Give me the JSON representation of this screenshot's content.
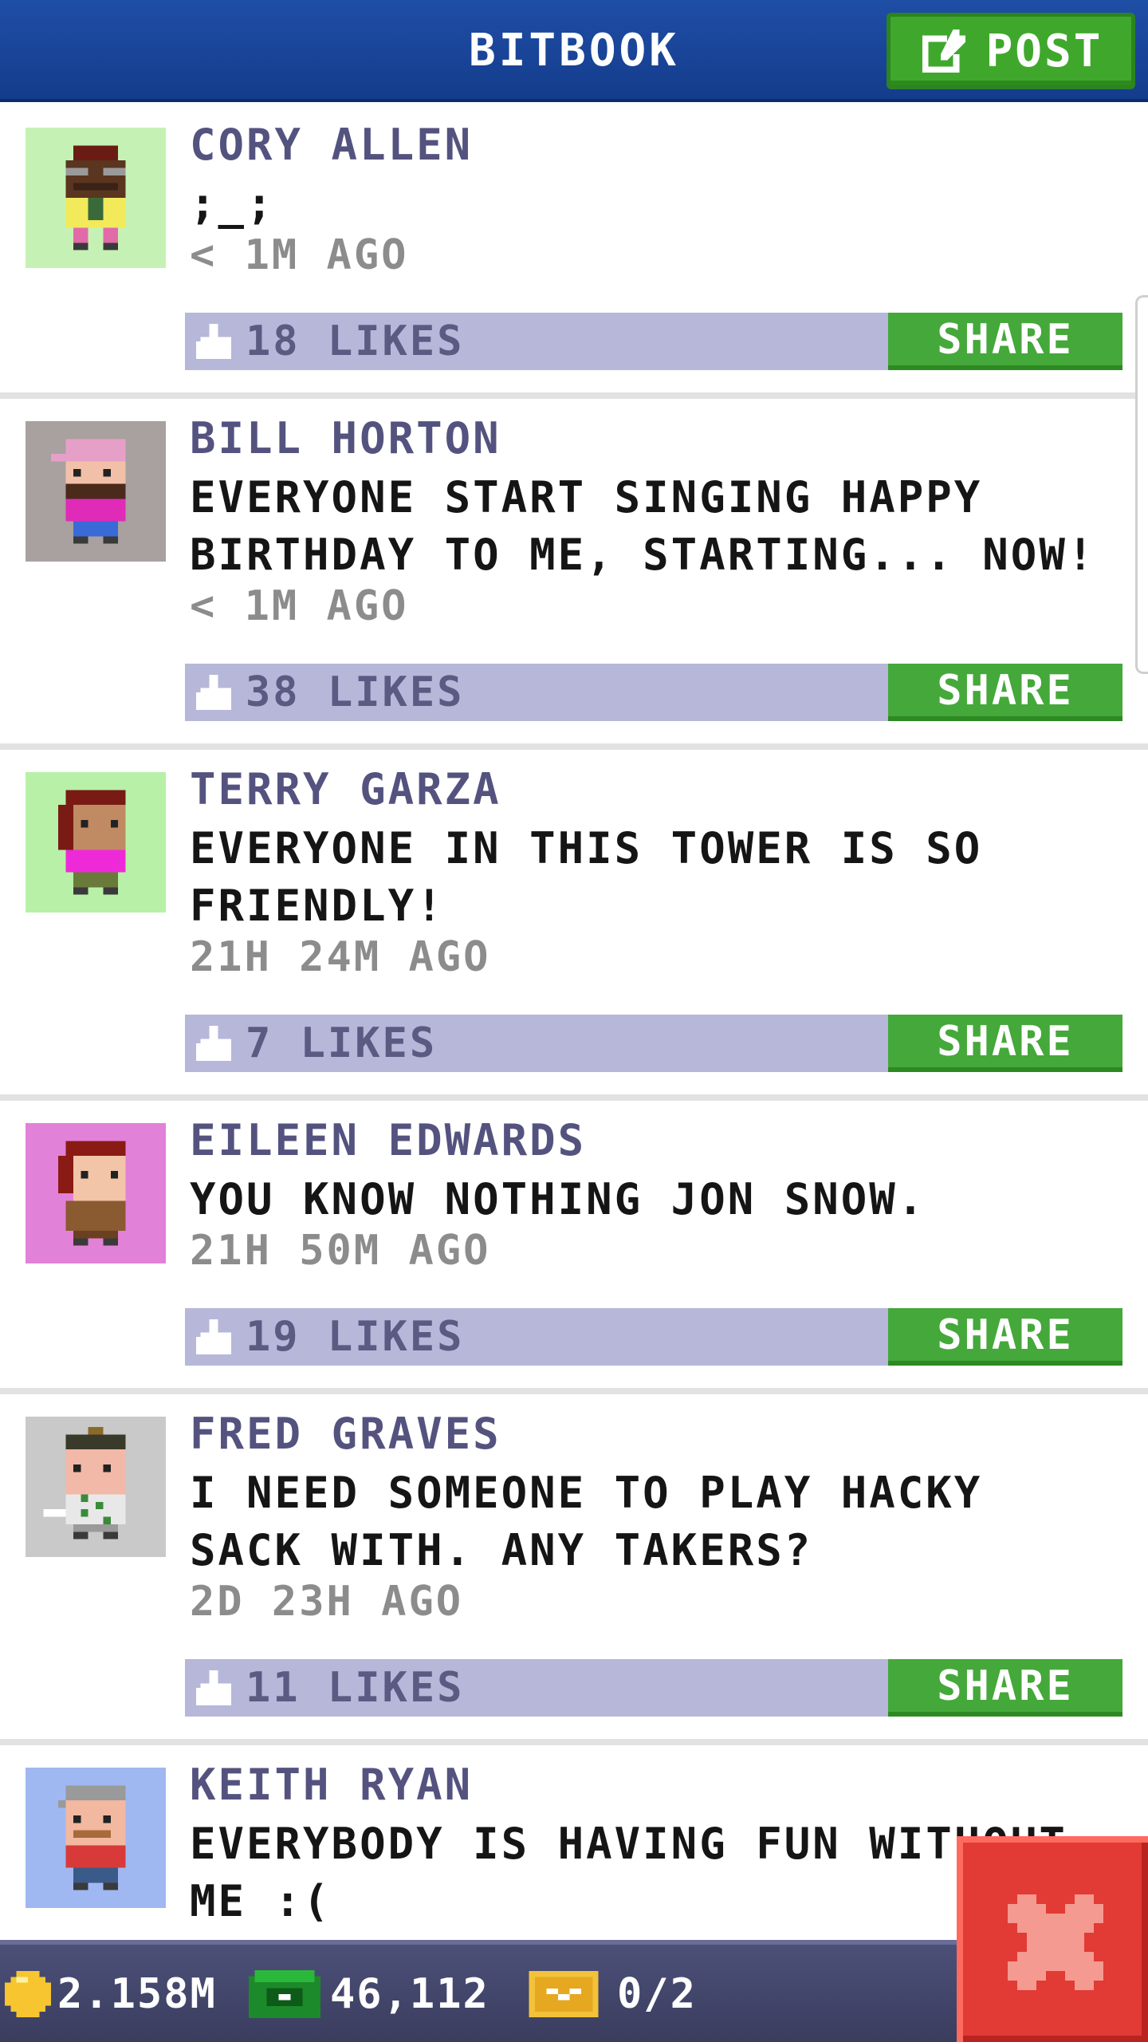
{
  "header": {
    "title": "BITBOOK",
    "post_button": "POST"
  },
  "posts": [
    {
      "author": "CORY ALLEN",
      "message": ";_;",
      "time": "< 1M AGO",
      "likes": "18 LIKES",
      "share": "SHARE",
      "avatar_bg": "#c5f2b4"
    },
    {
      "author": "BILL HORTON",
      "message": "EVERYONE START SINGING HAPPY BIRTHDAY TO ME, STARTING... NOW!",
      "time": "< 1M AGO",
      "likes": "38 LIKES",
      "share": "SHARE",
      "avatar_bg": "#a9a0a0"
    },
    {
      "author": "TERRY GARZA",
      "message": "EVERYONE IN THIS TOWER IS SO FRIENDLY!",
      "time": "21H 24M AGO",
      "likes": "7 LIKES",
      "share": "SHARE",
      "avatar_bg": "#b8f0a8"
    },
    {
      "author": "EILEEN EDWARDS",
      "message": "YOU KNOW NOTHING JON SNOW.",
      "time": "21H 50M AGO",
      "likes": "19 LIKES",
      "share": "SHARE",
      "avatar_bg": "#e281d8"
    },
    {
      "author": "FRED GRAVES",
      "message": "I NEED SOMEONE TO PLAY HACKY SACK WITH. ANY TAKERS?",
      "time": "2D 23H AGO",
      "likes": "11 LIKES",
      "share": "SHARE",
      "avatar_bg": "#c9c9c9"
    },
    {
      "author": "KEITH RYAN",
      "message": "EVERYBODY IS HAVING FUN WITHOUT ME :(",
      "time": "",
      "likes": "",
      "share": "",
      "avatar_bg": "#9fb8f2"
    }
  ],
  "bottom_bar": {
    "coins": "2.158M",
    "bux": "46,112",
    "tickets": "0/2"
  },
  "icons": {
    "post": "edit-icon",
    "like": "thumbs-up-icon",
    "coin": "coin-icon",
    "bux": "bux-icon",
    "ticket": "ticket-icon",
    "close": "close-icon"
  },
  "colors": {
    "header": "#1f4ea6",
    "accent_green": "#45a83a",
    "likes_bar": "#b6b7d9",
    "author_text": "#54537f",
    "close_red": "#e23a35"
  }
}
